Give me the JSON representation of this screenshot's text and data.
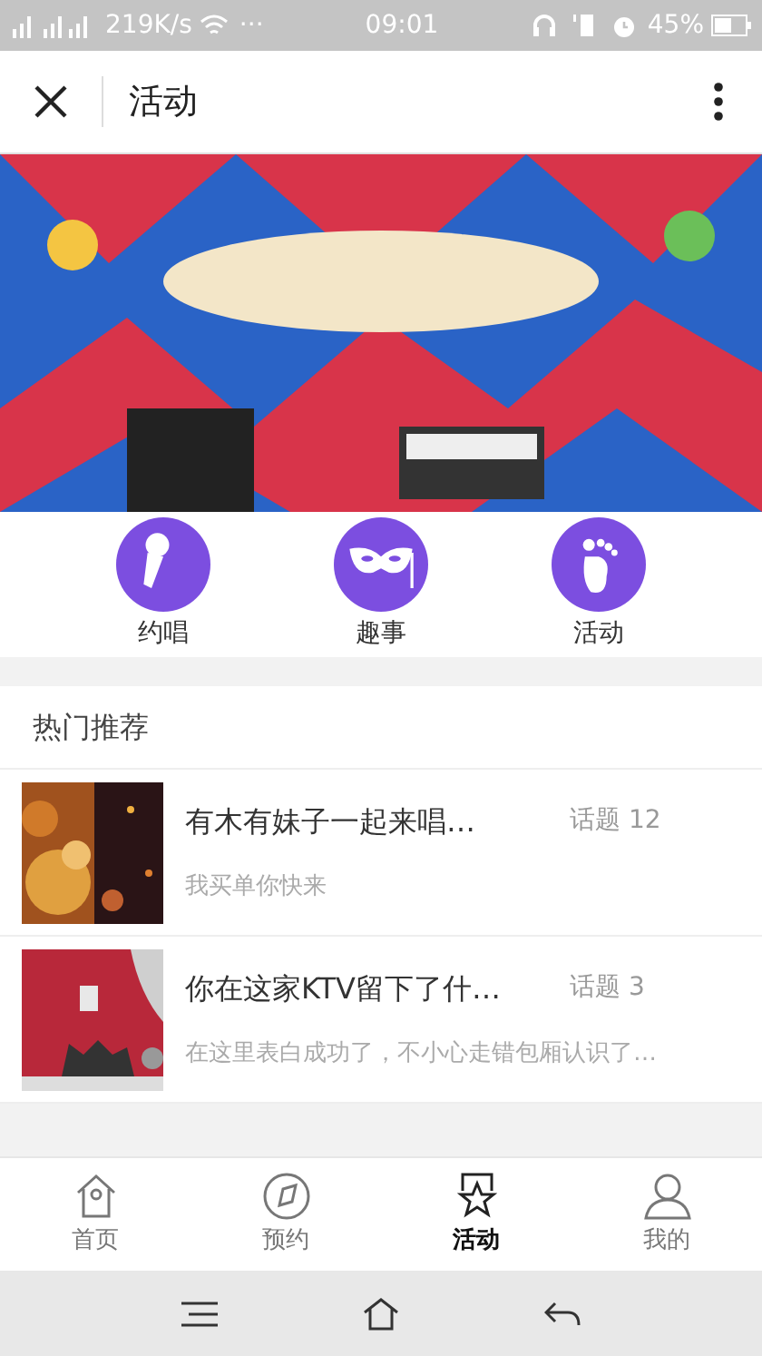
{
  "status_bar": {
    "speed": "219K/s",
    "dots": "···",
    "time": "09:01",
    "battery": "45%"
  },
  "header": {
    "title": "活动"
  },
  "categories": [
    {
      "label": "约唱"
    },
    {
      "label": "趣事"
    },
    {
      "label": "活动"
    }
  ],
  "section": {
    "title": "热门推荐"
  },
  "topics": [
    {
      "title": "有木有妹子一起来唱…",
      "count": "话题 12",
      "subtitle": "我买单你快来"
    },
    {
      "title": "你在这家KTV留下了什…",
      "count": "话题 3",
      "subtitle": "在这里表白成功了，不小心走错包厢认识了…"
    }
  ],
  "tab_bar": [
    {
      "label": "首页",
      "selected": false
    },
    {
      "label": "预约",
      "selected": false
    },
    {
      "label": "活动",
      "selected": true
    },
    {
      "label": "我的",
      "selected": false
    }
  ]
}
